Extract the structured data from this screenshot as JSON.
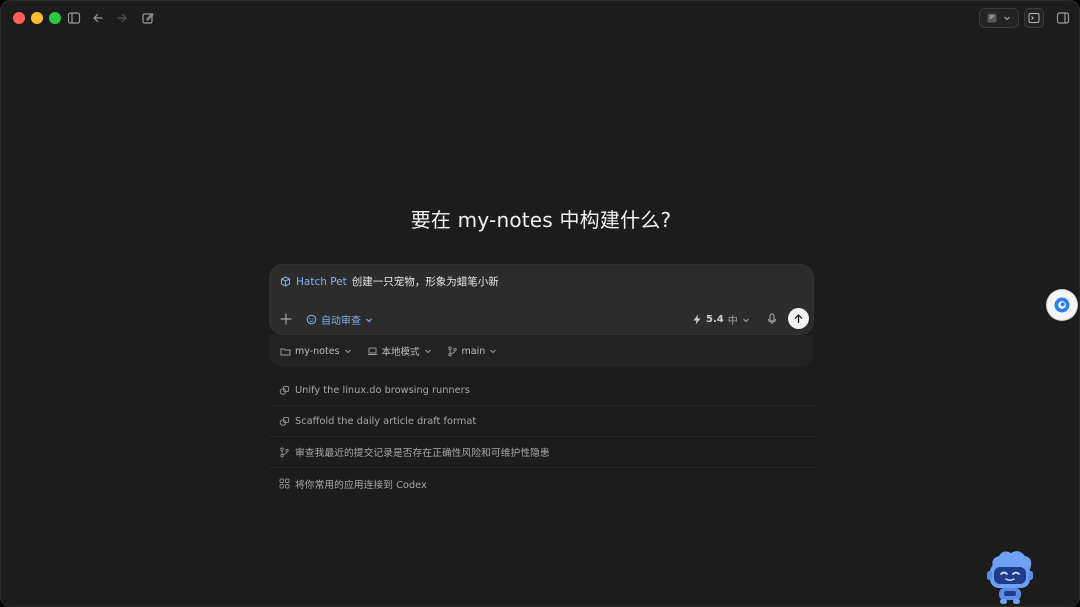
{
  "titlebar": {
    "icons": [
      "sidebar-toggle-icon",
      "back-arrow-icon",
      "forward-arrow-icon",
      "new-chat-icon",
      "terminal-icon",
      "panel-toggle-icon"
    ]
  },
  "main": {
    "heading": "要在 my-notes 中构建什么?"
  },
  "composer": {
    "skill_label": "Hatch Pet",
    "prompt_text": "创建一只宠物，形象为蜡笔小新",
    "approval_mode": "自动审查",
    "model_version": "5.4",
    "reasoning_level": "中"
  },
  "context": {
    "project": "my-notes",
    "environment": "本地模式",
    "branch": "main"
  },
  "suggestions": [
    {
      "icon": "linked-rings-icon",
      "text": "Unify the linux.do browsing runners"
    },
    {
      "icon": "linked-rings-icon",
      "text": "Scaffold the daily article draft format"
    },
    {
      "icon": "git-branch-icon",
      "text": "审查我最近的提交记录是否存在正确性风险和可维护性隐患"
    },
    {
      "icon": "apps-grid-icon",
      "text": "将你常用的应用连接到 Codex"
    }
  ],
  "colors": {
    "background": "#1c1c1c",
    "composer": "#2c2c2c",
    "accent": "#7db4f0",
    "close": "#ff5f57",
    "minimize": "#febc2e",
    "maximize": "#28c840"
  }
}
